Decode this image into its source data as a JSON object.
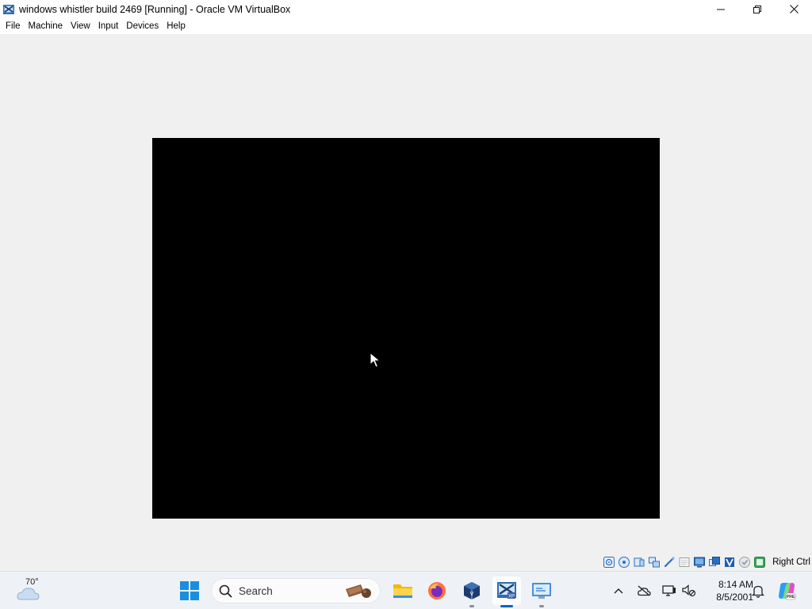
{
  "window": {
    "title": "windows whistler build 2469 [Running] - Oracle VM VirtualBox",
    "icon": "virtualbox-vm-icon",
    "controls": [
      "minimize-icon",
      "maximize-icon",
      "close-icon"
    ]
  },
  "menu": {
    "items": [
      "File",
      "Machine",
      "View",
      "Input",
      "Devices",
      "Help"
    ]
  },
  "statusbar": {
    "icons": [
      "hard-disk-icon",
      "optical-drive-icon",
      "audio-icon",
      "network-icon",
      "usb-icon",
      "shared-folders-icon",
      "display-icon",
      "recording-icon",
      "cpu-icon",
      "vt-x-icon",
      "mouse-integration-icon",
      "keyboard-icon"
    ],
    "host_key": "Right Ctrl"
  },
  "taskbar": {
    "weather": {
      "temp": "70°",
      "icon": "cloud-weather-icon"
    },
    "search": {
      "label": "Search"
    },
    "apps": [
      "start-icon",
      "file-explorer-icon",
      "firefox-icon",
      "virtualbox-manager-icon",
      "virtualbox-vm-icon",
      "remote-desktop-icon"
    ],
    "tray": {
      "icons": [
        "chevron-up-icon",
        "onedrive-icon",
        "display-network-icon",
        "mute-icon",
        "notifications-icon",
        "copilot-icon"
      ],
      "time": "8:14 AM",
      "date": "8/5/2001"
    }
  },
  "colors": {
    "vm_screen": "#000000",
    "accent": "#0067c0",
    "background": "#f0f0f0"
  }
}
